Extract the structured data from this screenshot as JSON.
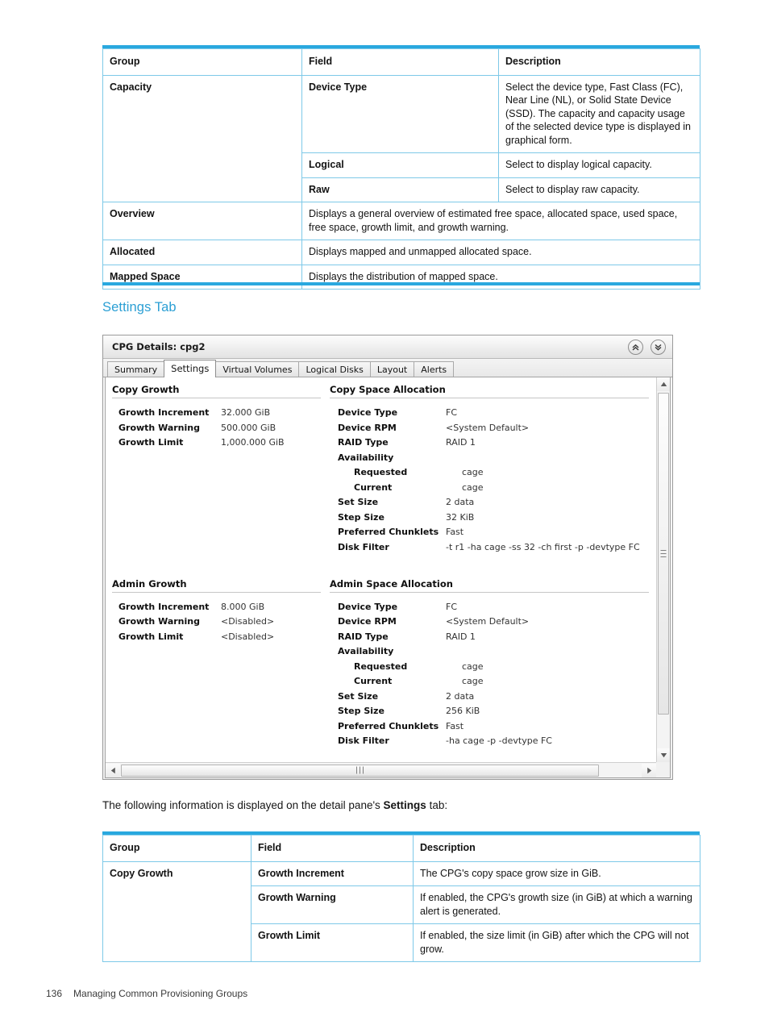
{
  "colors": {
    "table_border": "#7ec9e8",
    "table_rule": "#29a8df",
    "heading": "#2b9fd4"
  },
  "table_top": {
    "headers": [
      "Group",
      "Field",
      "Description"
    ],
    "rows": [
      {
        "group": "Capacity",
        "fields": [
          {
            "field": "Device Type",
            "description": "Select the device type, Fast Class (FC), Near Line (NL), or Solid State Device (SSD). The capacity and capacity usage of the selected device type is displayed in graphical form."
          },
          {
            "field": "Logical",
            "description": "Select to display logical capacity."
          },
          {
            "field": "Raw",
            "description": "Select to display raw capacity."
          }
        ]
      },
      {
        "group": "Overview",
        "description": "Displays a general overview of estimated free space, allocated space, used space, free space, growth limit, and growth warning."
      },
      {
        "group": "Allocated",
        "description": "Displays mapped and unmapped allocated space."
      },
      {
        "group": "Mapped Space",
        "description": "Displays the distribution of mapped space."
      }
    ]
  },
  "section_heading": "Settings Tab",
  "app": {
    "title": "CPG Details: cpg2",
    "titlebar_buttons": [
      {
        "name": "collapse-button",
        "icon": "double-chevron-up-icon"
      },
      {
        "name": "expand-button",
        "icon": "double-chevron-down-icon"
      }
    ],
    "tabs": [
      {
        "label": "Summary",
        "active": false
      },
      {
        "label": "Settings",
        "active": true
      },
      {
        "label": "Virtual Volumes",
        "active": false
      },
      {
        "label": "Logical Disks",
        "active": false
      },
      {
        "label": "Layout",
        "active": false
      },
      {
        "label": "Alerts",
        "active": false
      }
    ],
    "panes": {
      "copy_growth": {
        "title": "Copy Growth",
        "rows": [
          {
            "label": "Growth Increment",
            "value": "32.000 GiB"
          },
          {
            "label": "Growth Warning",
            "value": "500.000 GiB"
          },
          {
            "label": "Growth Limit",
            "value": "1,000.000 GiB"
          }
        ]
      },
      "copy_space_allocation": {
        "title": "Copy Space Allocation",
        "rows": [
          {
            "label": "Device Type",
            "value": "FC",
            "indent": false
          },
          {
            "label": "Device RPM",
            "value": "<System Default>",
            "indent": false
          },
          {
            "label": "RAID Type",
            "value": "RAID 1",
            "indent": false
          },
          {
            "label": "Availability",
            "value": "",
            "indent": false
          },
          {
            "label": "Requested",
            "value": "cage",
            "indent": true
          },
          {
            "label": "Current",
            "value": "cage",
            "indent": true
          },
          {
            "label": "Set Size",
            "value": "2 data",
            "indent": false
          },
          {
            "label": "Step Size",
            "value": "32 KiB",
            "indent": false
          },
          {
            "label": "Preferred Chunklets",
            "value": "Fast",
            "indent": false
          },
          {
            "label": "Disk Filter",
            "value": "-t r1 -ha cage -ss 32 -ch first -p -devtype FC",
            "indent": false
          }
        ]
      },
      "admin_growth": {
        "title": "Admin Growth",
        "rows": [
          {
            "label": "Growth Increment",
            "value": "8.000 GiB"
          },
          {
            "label": "Growth Warning",
            "value": "<Disabled>"
          },
          {
            "label": "Growth Limit",
            "value": "<Disabled>"
          }
        ]
      },
      "admin_space_allocation": {
        "title": "Admin Space Allocation",
        "rows": [
          {
            "label": "Device Type",
            "value": "FC",
            "indent": false
          },
          {
            "label": "Device RPM",
            "value": "<System Default>",
            "indent": false
          },
          {
            "label": "RAID Type",
            "value": "RAID 1",
            "indent": false
          },
          {
            "label": "Availability",
            "value": "",
            "indent": false
          },
          {
            "label": "Requested",
            "value": "cage",
            "indent": true
          },
          {
            "label": "Current",
            "value": "cage",
            "indent": true
          },
          {
            "label": "Set Size",
            "value": "2 data",
            "indent": false
          },
          {
            "label": "Step Size",
            "value": "256 KiB",
            "indent": false
          },
          {
            "label": "Preferred Chunklets",
            "value": "Fast",
            "indent": false
          },
          {
            "label": "Disk Filter",
            "value": "-ha cage -p -devtype FC",
            "indent": false
          }
        ]
      }
    }
  },
  "paragraph": {
    "before": "The following information is displayed on the detail pane's ",
    "bold": "Settings",
    "after": " tab:"
  },
  "table_bottom": {
    "headers": [
      "Group",
      "Field",
      "Description"
    ],
    "group": "Copy Growth",
    "rows": [
      {
        "field": "Growth Increment",
        "description": "The CPG's copy space grow size in GiB."
      },
      {
        "field": "Growth Warning",
        "description": "If enabled, the CPG's growth size (in GiB) at which a warning alert is generated."
      },
      {
        "field": "Growth Limit",
        "description": "If enabled, the size limit (in GiB) after which the CPG will not grow."
      }
    ]
  },
  "footer": {
    "page": "136",
    "chapter": "Managing Common Provisioning Groups"
  }
}
